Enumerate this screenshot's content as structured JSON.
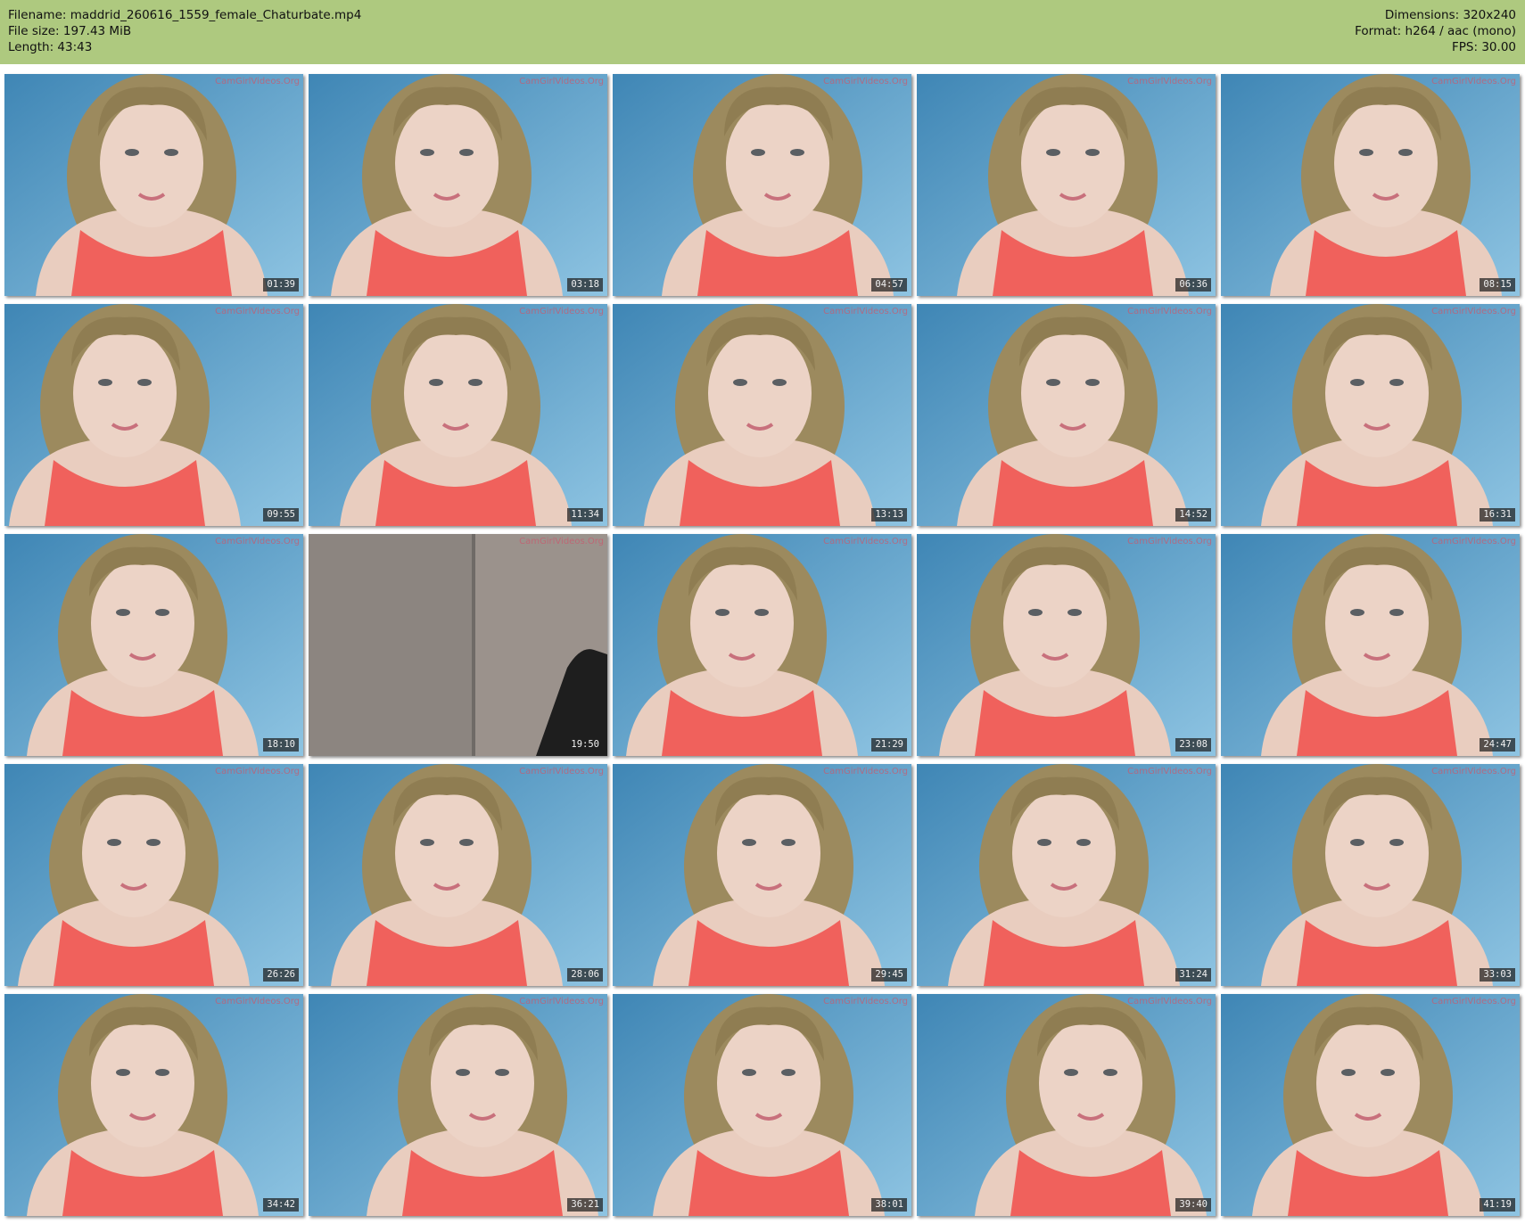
{
  "header": {
    "left": [
      {
        "label": "Filename:",
        "value": "maddrid_260616_1559_female_Chaturbate.mp4"
      },
      {
        "label": "File size:",
        "value": "197.43 MiB"
      },
      {
        "label": "Length:",
        "value": "43:43"
      }
    ],
    "right": [
      {
        "label": "Dimensions:",
        "value": "320x240"
      },
      {
        "label": "Format:",
        "value": "h264 / aac (mono)"
      },
      {
        "label": "FPS:",
        "value": "30.00"
      }
    ]
  },
  "watermark": "CamGirlVideos.Org",
  "thumbnails": [
    {
      "time": "01:39",
      "scene": "person"
    },
    {
      "time": "03:18",
      "scene": "person"
    },
    {
      "time": "04:57",
      "scene": "person"
    },
    {
      "time": "06:36",
      "scene": "person"
    },
    {
      "time": "08:15",
      "scene": "person"
    },
    {
      "time": "09:55",
      "scene": "person"
    },
    {
      "time": "11:34",
      "scene": "person"
    },
    {
      "time": "13:13",
      "scene": "person"
    },
    {
      "time": "14:52",
      "scene": "person"
    },
    {
      "time": "16:31",
      "scene": "person"
    },
    {
      "time": "18:10",
      "scene": "person"
    },
    {
      "time": "19:50",
      "scene": "empty"
    },
    {
      "time": "21:29",
      "scene": "person"
    },
    {
      "time": "23:08",
      "scene": "person"
    },
    {
      "time": "24:47",
      "scene": "person"
    },
    {
      "time": "26:26",
      "scene": "person"
    },
    {
      "time": "28:06",
      "scene": "person"
    },
    {
      "time": "29:45",
      "scene": "person"
    },
    {
      "time": "31:24",
      "scene": "person"
    },
    {
      "time": "33:03",
      "scene": "person"
    },
    {
      "time": "34:42",
      "scene": "person"
    },
    {
      "time": "36:21",
      "scene": "person"
    },
    {
      "time": "38:01",
      "scene": "person"
    },
    {
      "time": "39:40",
      "scene": "person"
    },
    {
      "time": "41:19",
      "scene": "person"
    }
  ],
  "colors": {
    "header_bg": "#aec97f",
    "wall": "#6fa6c9",
    "hair": "#9c8a5e",
    "skin": "#e9cdbf",
    "top": "#f0615c"
  }
}
